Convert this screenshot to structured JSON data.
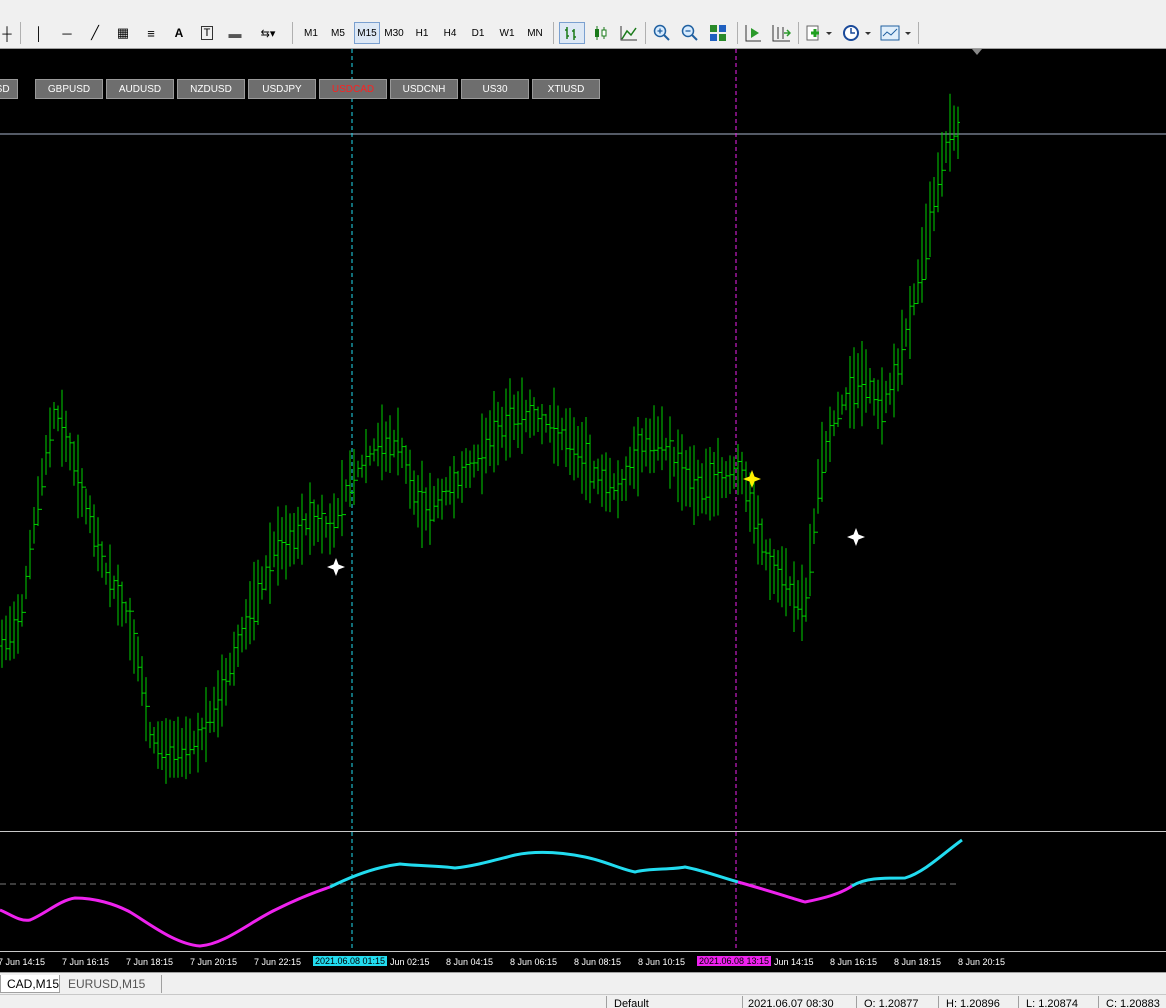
{
  "toolbar": {
    "items": [
      {
        "name": "crosshair-icon",
        "kind": "icon",
        "glyph": "┼"
      },
      {
        "name": "vertical-line-icon",
        "kind": "icon",
        "glyph": "│"
      },
      {
        "name": "horizontal-line-icon",
        "kind": "icon",
        "glyph": "─"
      },
      {
        "name": "trendline-icon",
        "kind": "icon",
        "glyph": "╱"
      },
      {
        "name": "channel-icon",
        "kind": "icon",
        "glyph": "▦"
      },
      {
        "name": "fibonacci-icon",
        "kind": "icon",
        "glyph": "≡"
      },
      {
        "name": "text-icon",
        "kind": "text",
        "glyph": "A"
      },
      {
        "name": "text-label-icon",
        "kind": "text",
        "glyph": "T"
      },
      {
        "name": "rectangle-icon",
        "kind": "icon",
        "glyph": "▬"
      },
      {
        "name": "arrows-dropdown-icon",
        "kind": "icon",
        "glyph": "⇆▾"
      }
    ],
    "timeframes": [
      "M1",
      "M5",
      "M15",
      "M30",
      "H1",
      "H4",
      "D1",
      "W1",
      "MN"
    ],
    "active_timeframe": "M15",
    "right_icons": [
      "bar-chart-icon",
      "candlestick-icon",
      "line-chart-icon",
      "zoom-in-icon",
      "zoom-out-icon",
      "tile-windows-icon",
      "chart-shift-icon",
      "autoscroll-icon",
      "indicators-icon",
      "periods-icon",
      "templates-icon"
    ]
  },
  "symbols": [
    "USD",
    "GBPUSD",
    "AUDUSD",
    "NZDUSD",
    "USDJPY",
    "USDCAD",
    "USDCNH",
    "US30",
    "XTIUSD"
  ],
  "active_symbol": "USDCAD",
  "time_axis": {
    "labels": [
      "7 Jun 14:15",
      "7 Jun 16:15",
      "7 Jun 18:15",
      "7 Jun 20:15",
      "7 Jun 22:15",
      "Jun 02:15",
      "8 Jun 04:15",
      "8 Jun 06:15",
      "8 Jun 08:15",
      "8 Jun 10:15",
      "Jun 14:15",
      "8 Jun 16:15",
      "8 Jun 18:15",
      "8 Jun 20:15"
    ],
    "marker_cyan": "2021.06.08 01:15",
    "marker_magenta": "2021.06.08 13:15"
  },
  "tabs": [
    "CAD,M15",
    "EURUSD,M15"
  ],
  "active_tab": "CAD,M15",
  "status": {
    "profile": "Default",
    "datetime": "2021.06.07 08:30",
    "open": "O: 1.20877",
    "high": "H: 1.20896",
    "low": "L: 1.20874",
    "close": "C: 1.20883"
  },
  "colors": {
    "bars": "#00d000",
    "cyan": "#22dcf0",
    "magenta": "#ee22ee",
    "star_white": "#ffffff",
    "star_yellow": "#ffee00",
    "active_symbol": "#ff2020",
    "hline": "#a8b4cc"
  }
}
